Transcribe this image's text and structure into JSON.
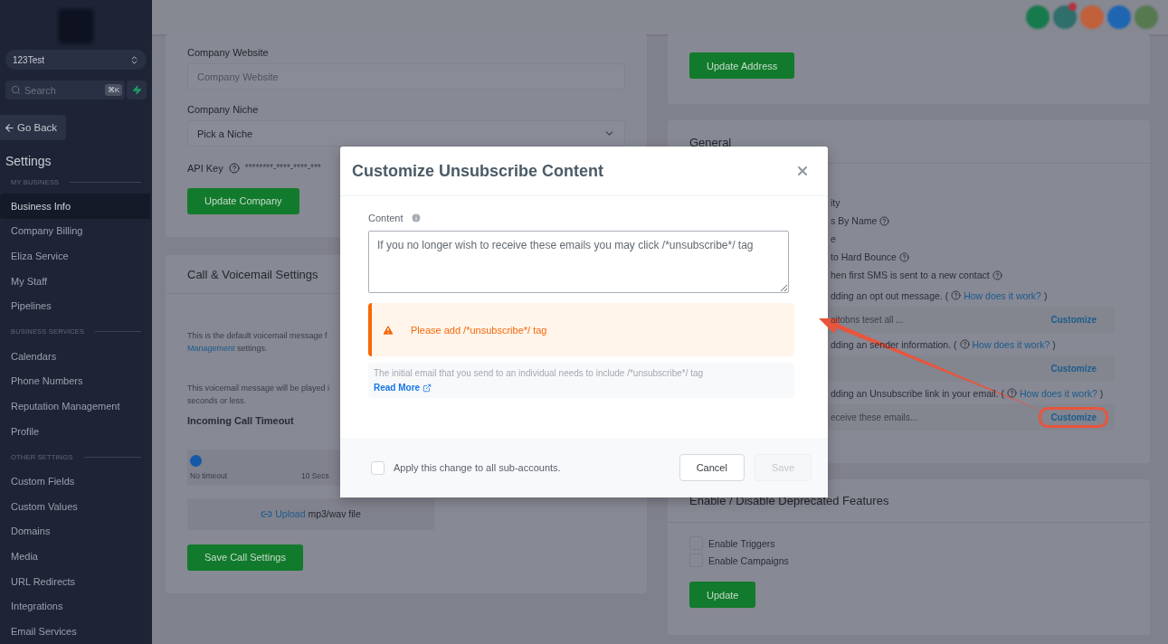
{
  "sidebar": {
    "account": "123Test",
    "search": {
      "placeholder": "Search",
      "shortcut": "⌘K"
    },
    "back": "Go Back",
    "title": "Settings",
    "sections": [
      {
        "label": "MY BUSINESS",
        "items": [
          {
            "label": "Business Info",
            "selected": true
          },
          {
            "label": "Company Billing",
            "selected": false
          },
          {
            "label": "Eliza Service",
            "selected": false
          },
          {
            "label": "My Staff",
            "selected": false
          },
          {
            "label": "Pipelines",
            "selected": false
          }
        ]
      },
      {
        "label": "BUSINESS SERVICES",
        "items": [
          {
            "label": "Calendars",
            "selected": false
          },
          {
            "label": "Phone Numbers",
            "selected": false
          },
          {
            "label": "Reputation Management",
            "selected": false
          },
          {
            "label": "Profile",
            "selected": false
          }
        ]
      },
      {
        "label": "OTHER SETTINGS",
        "items": [
          {
            "label": "Custom Fields",
            "selected": false
          },
          {
            "label": "Custom Values",
            "selected": false
          },
          {
            "label": "Domains",
            "selected": false
          },
          {
            "label": "Media",
            "selected": false
          },
          {
            "label": "URL Redirects",
            "selected": false
          },
          {
            "label": "Integrations",
            "selected": false
          },
          {
            "label": "Email Services",
            "selected": false
          }
        ]
      }
    ]
  },
  "header": {
    "avatars": [
      {
        "color": "#177a4c",
        "badge": false
      },
      {
        "color": "#2f6f6b",
        "badge": true
      },
      {
        "color": "#c0613b"
      },
      {
        "color": "#1f66b2"
      },
      {
        "color": "#56794f"
      }
    ]
  },
  "company": {
    "website": {
      "label": "Company Website",
      "placeholder": "Company Website"
    },
    "niche": {
      "label": "Company Niche",
      "value": "Pick a Niche"
    },
    "api_key": {
      "label": "API Key",
      "value": "********-****-****-***"
    },
    "button": "Update Company"
  },
  "voicemail": {
    "title": "Call & Voicemail Settings",
    "note_1": {
      "text": "This is the default voicemail message f",
      "link": "Management",
      "rest": " settings."
    },
    "note_2": {
      "lines": [
        "This voicemail message will be played i",
        "seconds or less."
      ]
    },
    "timeout": {
      "label": "Incoming Call Timeout",
      "level": 0,
      "marks": [
        "No timeout",
        "10 Secs"
      ]
    },
    "upload": {
      "link": "Upload",
      "text": " mp3/wav file"
    },
    "button": "Save Call Settings"
  },
  "address": {
    "button": "Update Address"
  },
  "general": {
    "title": "General",
    "rows": [
      {
        "kind": "option",
        "text": "ity",
        "help": false
      },
      {
        "kind": "option",
        "text": "s By Name",
        "help": true
      },
      {
        "kind": "option",
        "text": "e",
        "help": false
      },
      {
        "kind": "option",
        "text": "to Hard Bounce",
        "help": true
      },
      {
        "kind": "option",
        "text": "hen first SMS is sent to a new contact",
        "help": true
      },
      {
        "kind": "option",
        "text": "dding an opt out message. (",
        "help": true,
        "link": "How does it work?",
        "close": ")"
      },
      {
        "kind": "input",
        "value": "aitobns teset all ...",
        "action": "Customize",
        "highlighted": false
      },
      {
        "kind": "option",
        "text": "dding an sender information. (",
        "help": true,
        "link": "How does it work?",
        "close": ")"
      },
      {
        "kind": "input",
        "action": "Customize",
        "highlighted": false
      },
      {
        "kind": "option",
        "text": "dding an Unsubscribe link in your email. (",
        "help": true,
        "link": "How does it work?",
        "close": ")"
      },
      {
        "kind": "input",
        "value": "eceive these emails...",
        "action": "Customize",
        "highlighted": true
      }
    ]
  },
  "deprecated": {
    "title": "Enable / Disable Deprecated Features",
    "options": [
      {
        "label": "Enable Triggers",
        "checked": false
      },
      {
        "label": "Enable Campaigns",
        "checked": false
      }
    ],
    "button": "Update"
  },
  "modal": {
    "title": "Customize Unsubscribe Content",
    "content_label": "Content",
    "content": "If you no longer wish to receive these emails you may click /*unsubscribe*/ tag",
    "warning": "Please add /*unsubscribe*/ tag",
    "info": "The initial email that you send to an individual needs to include /*unsubscribe*/ tag",
    "read_more": "Read More",
    "apply": {
      "label": "Apply this change to all sub-accounts.",
      "checked": false
    },
    "cancel": "Cancel",
    "save": {
      "label": "Save",
      "disabled": true
    }
  }
}
